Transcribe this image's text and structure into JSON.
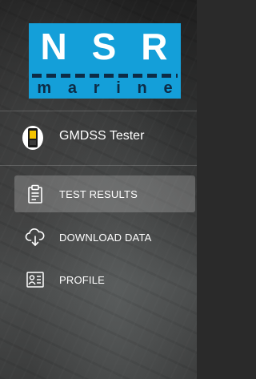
{
  "logo": {
    "top_text": [
      "N",
      "S",
      "R"
    ],
    "bottom_text": [
      "m",
      "a",
      "r",
      "i",
      "n",
      "e"
    ]
  },
  "device": {
    "label": "GMDSS Tester",
    "icon": "handheld-tester-icon"
  },
  "menu": {
    "items": [
      {
        "label": "TEST RESULTS",
        "icon": "clipboard-icon",
        "active": true
      },
      {
        "label": "DOWNLOAD DATA",
        "icon": "cloud-download-icon",
        "active": false
      },
      {
        "label": "PROFILE",
        "icon": "profile-card-icon",
        "active": false
      }
    ]
  },
  "colors": {
    "brand_blue": "#149fd9",
    "brand_navy": "#0d2c46",
    "text": "#ffffff"
  }
}
